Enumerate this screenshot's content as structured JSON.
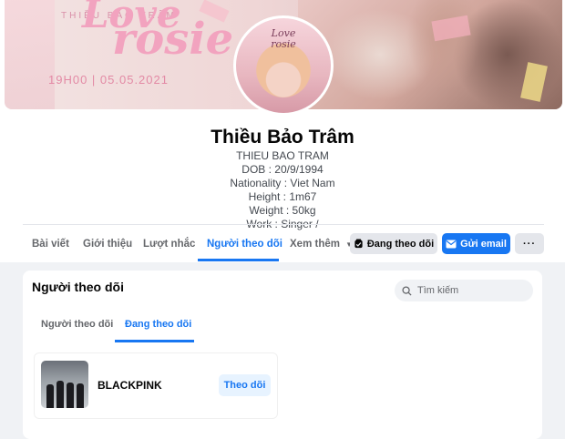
{
  "cover": {
    "title_line1": "Love",
    "title_line2": "rosie",
    "subtitle": "THIỀU BẢO TRÂM",
    "date": "19H00 | 05.05.2021"
  },
  "avatar": {
    "title_line1": "Love",
    "title_line2": "rosie"
  },
  "profile": {
    "name": "Thiều Bảo Trâm",
    "bio": [
      "THIEU BAO TRAM",
      "DOB : 20/9/1994",
      "Nationality : Viet Nam",
      "Height : 1m67",
      "Weight : 50kg",
      "Work : Singer /"
    ]
  },
  "tabs": [
    {
      "label": "Bài viết"
    },
    {
      "label": "Giới thiệu"
    },
    {
      "label": "Lượt nhắc"
    },
    {
      "label": "Người theo dõi",
      "active": true
    },
    {
      "label": "Xem thêm"
    }
  ],
  "actions": {
    "following_label": "Đang theo dõi",
    "message_label": "Gửi email",
    "more_label": "···"
  },
  "followers_section": {
    "title": "Người theo dõi",
    "search_placeholder": "Tìm kiếm",
    "subtabs": [
      {
        "label": "Người theo dõi"
      },
      {
        "label": "Đang theo dõi",
        "active": true
      }
    ],
    "items": [
      {
        "name": "BLACKPINK",
        "button_label": "Theo dõi"
      }
    ]
  },
  "colors": {
    "accent": "#1877f2",
    "background": "#f0f2f5",
    "text": "#050505",
    "secondary_text": "#65676b"
  }
}
